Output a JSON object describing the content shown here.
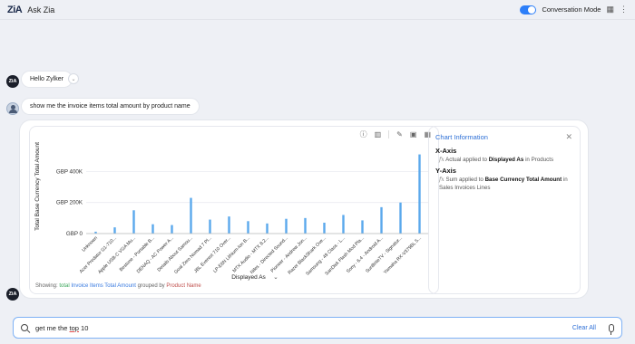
{
  "topbar": {
    "logo": "ZiA",
    "title": "Ask Zia",
    "conversation_mode_label": "Conversation Mode",
    "conversation_mode_on": true
  },
  "chat": {
    "zia_avatar": "ZiA",
    "greeting": "Hello Zylker",
    "user_query": "show me the invoice items total amount by product name",
    "answer_avatar": "ZiA"
  },
  "chart_data": {
    "type": "bar",
    "ylabel": "Total Base Currency Total Amount",
    "xlabel": "Displayed As",
    "yticks": [
      "GBP 0",
      "GBP 200K",
      "GBP 400K"
    ],
    "ytick_values": [
      0,
      200000,
      400000
    ],
    "ylim": [
      0,
      560000
    ],
    "categories": [
      "Unknown",
      "Acer Predator G1-710...",
      "Apple USB-C VGA Mu...",
      "Bestone - Portable B...",
      "DENAQ - AC Power A...",
      "Details About Samsu...",
      "Goal Zero Nomad 7 Pl...",
      "JBL Everest 710 Over...",
      "LP-E6N Lithium-Ion B...",
      "MTX Audio - MTX 8.2...",
      "Niles - Directed Sound...",
      "Pioneer - Andrew Jon...",
      "Razer BlackShark Ove...",
      "Samsung - 49 Class - L...",
      "SanDisk Flash Mod Pla...",
      "Sony - 6.4 - Android A...",
      "SunBriteTV - Signatur...",
      "Yamaha RX-V379BL 5..."
    ],
    "values": [
      12000,
      40000,
      150000,
      60000,
      55000,
      230000,
      90000,
      110000,
      80000,
      65000,
      95000,
      100000,
      70000,
      120000,
      85000,
      170000,
      200000,
      510000
    ],
    "color": "#5aa9ec",
    "grid": true
  },
  "chart_tools": {
    "info_icon": "info-icon",
    "chart_type_icon": "bar-chart-icon",
    "edit_icon": "pencil-icon",
    "save_icon": "save-icon",
    "dashboard_icon": "grid-icon"
  },
  "showing": {
    "prefix": "Showing:",
    "agg": "total",
    "measure": "Invoice Items Total Amount",
    "grouped": "grouped by",
    "dimension": "Product Name"
  },
  "info": {
    "title": "Chart Information",
    "x_axis_heading": "X-Axis",
    "x_fn": "Actual",
    "x_applied": "applied to",
    "x_field": "Displayed As",
    "x_in": "in",
    "x_table": "Products",
    "y_axis_heading": "Y-Axis",
    "y_fn": "Sum",
    "y_applied": "applied to",
    "y_field": "Base Currency Total Amount",
    "y_in": "in",
    "y_table": "Sales Invoices Lines"
  },
  "input": {
    "value_before": "get me the ",
    "value_underlined": "top",
    "value_after": " 10",
    "clear_all": "Clear All"
  }
}
